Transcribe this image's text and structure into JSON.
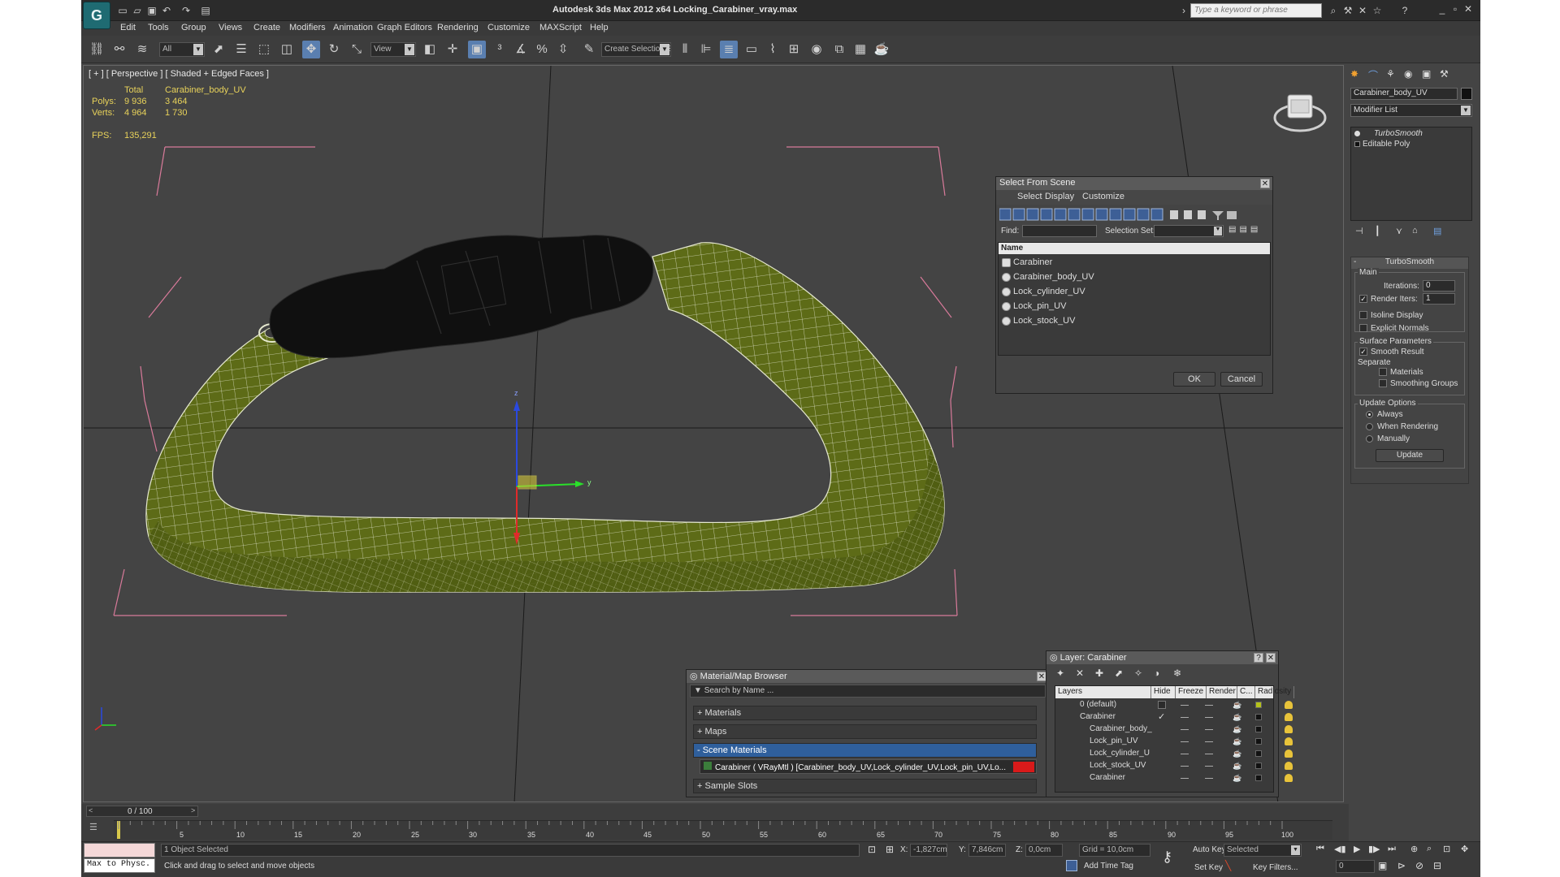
{
  "window": {
    "title": "Autodesk 3ds Max  2012 x64     Locking_Carabiner_vray.max",
    "search_placeholder": "Type a keyword or phrase"
  },
  "menu": [
    "Edit",
    "Tools",
    "Group",
    "Views",
    "Create",
    "Modifiers",
    "Animation",
    "Graph Editors",
    "Rendering",
    "Customize",
    "MAXScript",
    "Help"
  ],
  "toolbar": {
    "selection_filter": "All",
    "ref_coord": "View",
    "selection_set": "Create Selection Se"
  },
  "viewport": {
    "label": "[ + ] [ Perspective ] [ Shaded + Edged Faces ]",
    "stats": {
      "header_total": "Total",
      "header_object": "Carabiner_body_UV",
      "polys_label": "Polys:",
      "polys_total": "9 936",
      "polys_object": "3 464",
      "verts_label": "Verts:",
      "verts_total": "4 964",
      "verts_object": "1 730",
      "fps_label": "FPS:",
      "fps_value": "135,291"
    },
    "gizmo_labels": {
      "z": "z",
      "y": "y"
    }
  },
  "select_from_scene": {
    "title": "Select From Scene",
    "menu": [
      "Select",
      "Display",
      "Customize"
    ],
    "find_label": "Find:",
    "selection_set_label": "Selection Set:",
    "column_name": "Name",
    "items": [
      "Carabiner",
      "Carabiner_body_UV",
      "Lock_cylinder_UV",
      "Lock_pin_UV",
      "Lock_stock_UV"
    ],
    "ok": "OK",
    "cancel": "Cancel"
  },
  "material_browser": {
    "title": "Material/Map Browser",
    "search_placeholder": "Search by Name ...",
    "groups": [
      "+ Materials",
      "+ Maps",
      "- Scene Materials"
    ],
    "scene_material": "Carabiner  ( VRayMtl ) [Carabiner_body_UV,Lock_cylinder_UV,Lock_pin_UV,Lo...",
    "sample_slots": "+ Sample Slots"
  },
  "layer_manager": {
    "title": "Layer: Carabiner",
    "columns": [
      "Layers",
      "Hide",
      "Freeze",
      "Render",
      "C...",
      "Radiosity"
    ],
    "rows": [
      {
        "name": "0 (default)",
        "color": "#b5c21a"
      },
      {
        "name": "Carabiner",
        "color": "#111111"
      },
      {
        "name": "Carabiner_body_",
        "color": "#111111"
      },
      {
        "name": "Lock_pin_UV",
        "color": "#111111"
      },
      {
        "name": "Lock_cylinder_U",
        "color": "#111111"
      },
      {
        "name": "Lock_stock_UV",
        "color": "#111111"
      },
      {
        "name": "Carabiner",
        "color": "#111111"
      }
    ]
  },
  "command_panel": {
    "object_name": "Carabiner_body_UV",
    "modifier_list": "Modifier List",
    "stack": [
      "TurboSmooth",
      "Editable Poly"
    ],
    "turbosmooth": {
      "title": "TurboSmooth",
      "main": "Main",
      "iterations_label": "Iterations:",
      "iterations_value": "0",
      "render_iters_label": "Render Iters:",
      "render_iters_value": "1",
      "isoline": "Isoline Display",
      "explicit_normals": "Explicit Normals",
      "surface_params": "Surface Parameters",
      "smooth_result": "Smooth Result",
      "separate": "Separate",
      "materials": "Materials",
      "smoothing_groups": "Smoothing Groups",
      "update_options": "Update Options",
      "always": "Always",
      "when_rendering": "When Rendering",
      "manually": "Manually",
      "update": "Update"
    }
  },
  "timeline": {
    "frame": "0 / 100",
    "ticks": [
      "5",
      "10",
      "15",
      "20",
      "25",
      "30",
      "35",
      "40",
      "45",
      "50",
      "55",
      "60",
      "65",
      "70",
      "75",
      "80",
      "85",
      "90",
      "95",
      "100"
    ]
  },
  "status": {
    "maxscript": "Max to Physc.",
    "selected": "1 Object Selected",
    "prompt": "Click and drag to select and move objects",
    "x_label": "X:",
    "x_value": "-1,827cm",
    "y_label": "Y:",
    "y_value": "7,846cm",
    "z_label": "Z:",
    "z_value": "0,0cm",
    "grid": "Grid = 10,0cm",
    "add_time_tag": "Add Time Tag",
    "auto_key": "Auto Key",
    "set_key": "Set Key",
    "key_mode": "Selected",
    "key_filters": "Key Filters...",
    "frame_value": "0"
  },
  "colors": {
    "mesh_fill": "#5d6b17",
    "lock_black": "#101010",
    "bbox_pink": "#d87a9a",
    "selection_blue": "#2f5f9c"
  }
}
